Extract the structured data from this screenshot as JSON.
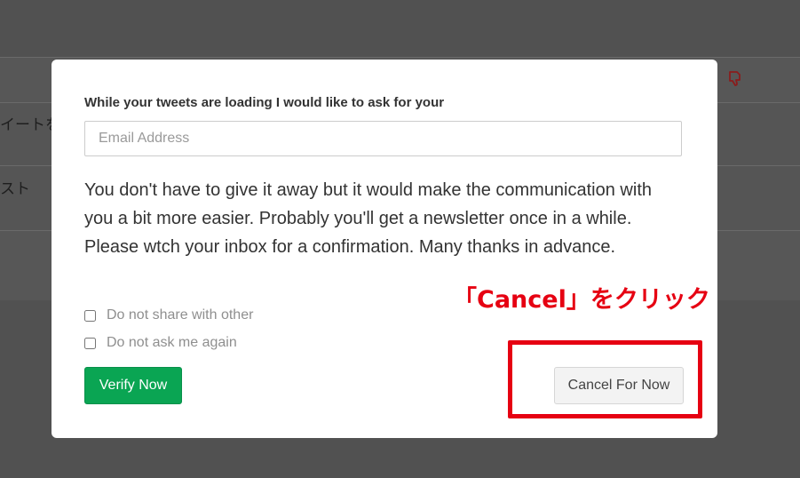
{
  "background": {
    "row_texts": [
      "イートを",
      "スト"
    ],
    "icon": "thumbs-down-icon"
  },
  "modal": {
    "prompt": "While your tweets are loading I would like to ask for your",
    "email_placeholder": "Email Address",
    "email_value": "",
    "description": "You don't have to give it away but it would make the communication with you a bit more easier. Probably you'll get a newsletter once in a while. Please wtch your inbox for a confirmation. Many thanks in advance.",
    "checkboxes": [
      {
        "label": "Do not share with other",
        "checked": false
      },
      {
        "label": "Do not ask me again",
        "checked": false
      }
    ],
    "verify_label": "Verify Now",
    "cancel_label": "Cancel For Now"
  },
  "annotation": {
    "text": "「Cancel」をクリック",
    "color": "#e60012"
  },
  "colors": {
    "verify_green": "#0aa553",
    "overlay": "#515151"
  }
}
